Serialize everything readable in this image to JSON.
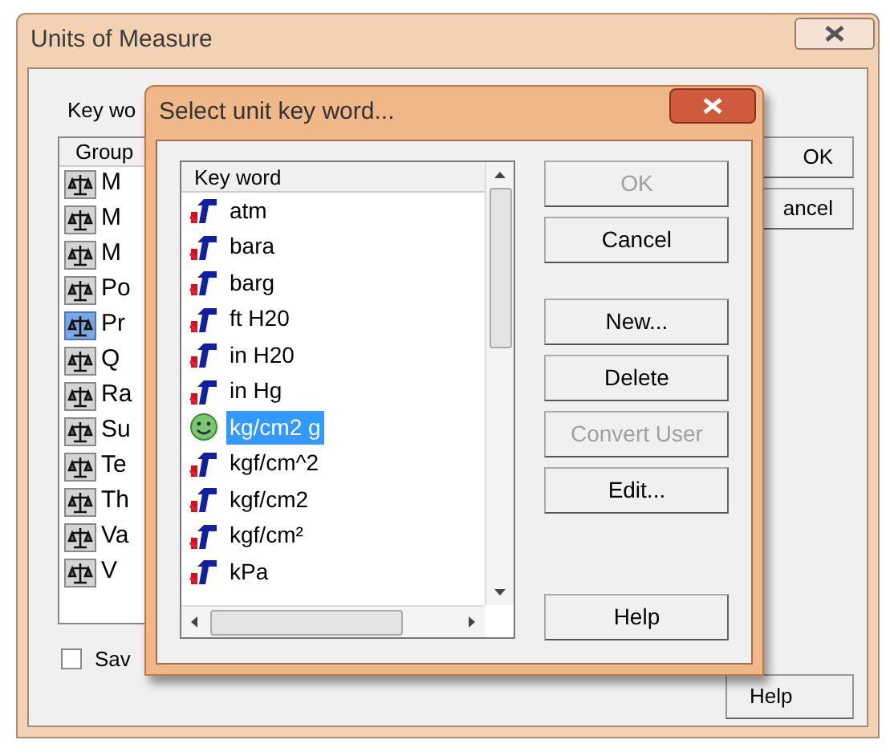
{
  "outer_window": {
    "title": "Units of Measure",
    "label": "Key wo",
    "group_list": {
      "header": "Group",
      "rows": [
        {
          "label": "M",
          "selected": false
        },
        {
          "label": "M",
          "selected": false
        },
        {
          "label": "M",
          "selected": false
        },
        {
          "label": "Po",
          "selected": false
        },
        {
          "label": "Pr",
          "selected": true
        },
        {
          "label": "Q",
          "selected": false
        },
        {
          "label": "Ra",
          "selected": false
        },
        {
          "label": "Su",
          "selected": false
        },
        {
          "label": "Te",
          "selected": false
        },
        {
          "label": "Th",
          "selected": false
        },
        {
          "label": "Va",
          "selected": false
        },
        {
          "label": "V",
          "selected": false
        }
      ]
    },
    "checkbox": {
      "label": "Sav",
      "checked": false
    },
    "buttons": [
      "OK",
      "ancel"
    ],
    "help_button": "Help"
  },
  "dialog": {
    "title": "Select unit key word...",
    "list": {
      "header": "Key word",
      "items": [
        {
          "label": "atm",
          "kind": "unit",
          "selected": false
        },
        {
          "label": "bara",
          "kind": "unit",
          "selected": false
        },
        {
          "label": "barg",
          "kind": "unit",
          "selected": false
        },
        {
          "label": "ft H20",
          "kind": "unit",
          "selected": false
        },
        {
          "label": "in H20",
          "kind": "unit",
          "selected": false
        },
        {
          "label": "in Hg",
          "kind": "unit",
          "selected": false
        },
        {
          "label": "kg/cm2 g",
          "kind": "user",
          "selected": true
        },
        {
          "label": "kgf/cm^2",
          "kind": "unit",
          "selected": false
        },
        {
          "label": "kgf/cm2",
          "kind": "unit",
          "selected": false
        },
        {
          "label": "kgf/cm²",
          "kind": "unit",
          "selected": false
        },
        {
          "label": "kPa",
          "kind": "unit",
          "selected": false
        }
      ]
    },
    "buttons": [
      {
        "label": "OK",
        "disabled": true
      },
      {
        "label": "Cancel",
        "disabled": false
      },
      {
        "label": "New...",
        "disabled": false
      },
      {
        "label": "Delete",
        "disabled": false
      },
      {
        "label": "Convert User",
        "disabled": true
      },
      {
        "label": "Edit...",
        "disabled": false
      },
      {
        "label": "Help",
        "disabled": false
      }
    ]
  }
}
